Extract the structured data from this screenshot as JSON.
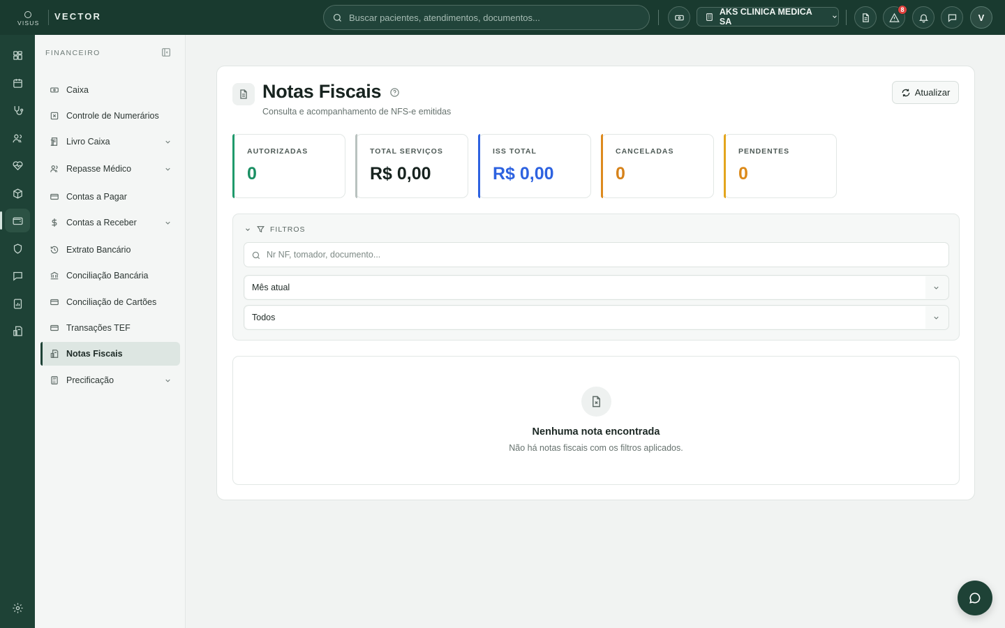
{
  "brand": {
    "logo_text": "VISUS",
    "app_name": "VECTOR"
  },
  "topbar": {
    "search_placeholder": "Buscar pacientes, atendimentos, documentos...",
    "clinic_name": "AKS CLINICA MEDICA SA",
    "alerts_count": "8",
    "user_initial": "V"
  },
  "sidebar": {
    "section_title": "FINANCEIRO",
    "items": [
      {
        "label": "Caixa",
        "icon": "cash-register-icon",
        "expandable": false
      },
      {
        "label": "Controle de Numerários",
        "icon": "square-x-icon",
        "expandable": false
      },
      {
        "label": "Livro Caixa",
        "icon": "ledger-icon",
        "expandable": true
      },
      {
        "label": "Repasse Médico",
        "icon": "users-icon",
        "expandable": true
      },
      {
        "label": "Contas a Pagar",
        "icon": "credit-card-icon",
        "expandable": false
      },
      {
        "label": "Contas a Receber",
        "icon": "dollar-icon",
        "expandable": true
      },
      {
        "label": "Extrato Bancário",
        "icon": "history-icon",
        "expandable": false
      },
      {
        "label": "Conciliação Bancária",
        "icon": "bank-icon",
        "expandable": false
      },
      {
        "label": "Conciliação de Cartões",
        "icon": "credit-card-icon",
        "expandable": false
      },
      {
        "label": "Transações TEF",
        "icon": "credit-card-icon",
        "expandable": false
      },
      {
        "label": "Notas Fiscais",
        "icon": "receipt-icon",
        "expandable": false,
        "active": true
      },
      {
        "label": "Precificação",
        "icon": "calculator-icon",
        "expandable": true
      }
    ]
  },
  "page": {
    "title": "Notas Fiscais",
    "subtitle": "Consulta e acompanhamento de NFS-e emitidas",
    "refresh_label": "Atualizar"
  },
  "stats": [
    {
      "label": "AUTORIZADAS",
      "value": "0",
      "color": "#1a8f63"
    },
    {
      "label": "TOTAL SERVIÇOS",
      "value": "R$ 0,00",
      "color": "#17231f"
    },
    {
      "label": "ISS TOTAL",
      "value": "R$ 0,00",
      "color": "#2d62e0"
    },
    {
      "label": "CANCELADAS",
      "value": "0",
      "color": "#d6821a"
    },
    {
      "label": "PENDENTES",
      "value": "0",
      "color": "#dc8a1a"
    }
  ],
  "filters": {
    "title": "FILTROS",
    "search_placeholder": "Nr NF, tomador, documento...",
    "period_value": "Mês atual",
    "status_value": "Todos"
  },
  "empty_state": {
    "title": "Nenhuma nota encontrada",
    "text": "Não há notas fiscais com os filtros aplicados."
  }
}
